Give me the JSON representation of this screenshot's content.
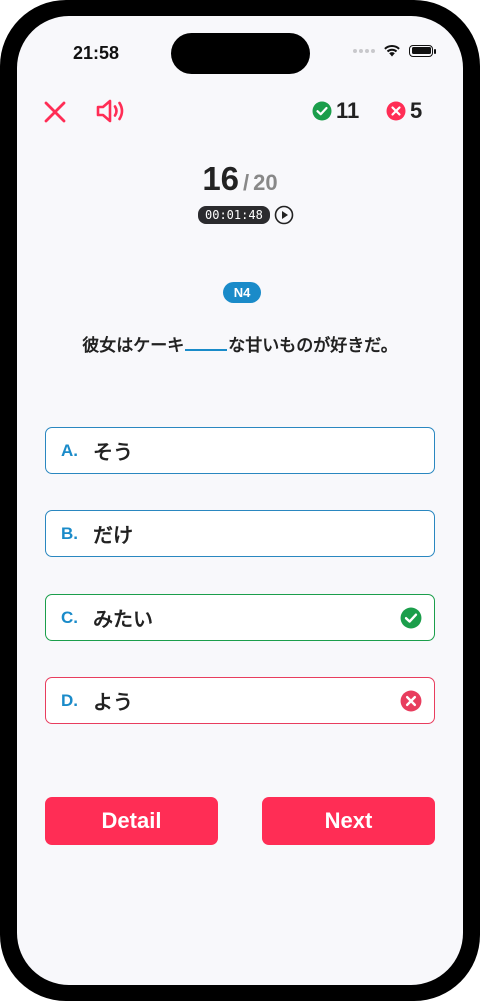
{
  "status_bar": {
    "time": "21:58"
  },
  "score": {
    "correct": "11",
    "wrong": "5"
  },
  "progress": {
    "current": "16",
    "separator": "/",
    "total": "20",
    "timer": "00:01:48"
  },
  "level": "N4",
  "question": {
    "before_blank": "彼女はケーキ",
    "after_blank": "な甘いものが好きだ。"
  },
  "options": [
    {
      "letter": "A.",
      "text": "そう",
      "state": "neutral"
    },
    {
      "letter": "B.",
      "text": "だけ",
      "state": "neutral"
    },
    {
      "letter": "C.",
      "text": "みたい",
      "state": "correct"
    },
    {
      "letter": "D.",
      "text": "よう",
      "state": "wrong"
    }
  ],
  "buttons": {
    "detail": "Detail",
    "next": "Next"
  },
  "icons": {
    "close": "close-icon",
    "sound": "speaker-icon",
    "correct": "check-circle-icon",
    "wrong": "x-circle-icon",
    "play": "play-circle-icon"
  },
  "colors": {
    "accent": "#ff2d55",
    "level_blue": "#1a8bc9",
    "correct_green": "#1b9e4b",
    "wrong_red": "#e83d5e"
  }
}
